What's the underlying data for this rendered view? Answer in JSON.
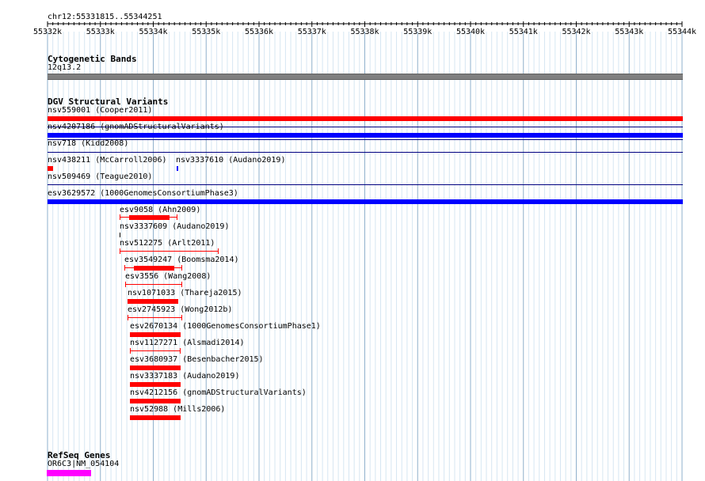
{
  "header": {
    "location": "chr12:55331815..55344251",
    "ticks": [
      "55332k",
      "55333k",
      "55334k",
      "55335k",
      "55336k",
      "55337k",
      "55338k",
      "55339k",
      "55340k",
      "55341k",
      "55342k",
      "55343k",
      "55344k"
    ]
  },
  "tracks": {
    "cytoband": {
      "title": "Cytogenetic Bands",
      "band": "12q13.2",
      "color": "#808080"
    },
    "dgv": {
      "title": "DGV Structural Variants",
      "colors": {
        "gain": "#ff0000",
        "loss": "#0000ff",
        "separator": "#000080"
      },
      "rows": [
        {
          "label": "nsv559001 (Cooper2011)"
        },
        {
          "label": "nsv4207186 (gnomADStructuralVariants)"
        },
        {
          "label": "nsv718 (Kidd2008)"
        },
        {
          "label": "nsv438211 (McCarroll2006)",
          "label2": "nsv3337610 (Audano2019)"
        },
        {
          "label": "nsv509469 (Teague2010)"
        },
        {
          "label": "esv3629572 (1000GenomesConsortiumPhase3)"
        },
        {
          "label": "esv9058 (Ahn2009)"
        },
        {
          "label": "nsv3337609 (Audano2019)"
        },
        {
          "label": "nsv512275 (Arlt2011)"
        },
        {
          "label": "esv3549247 (Boomsma2014)"
        },
        {
          "label": "esv3556 (Wang2008)"
        },
        {
          "label": "nsv1071033 (Thareja2015)"
        },
        {
          "label": "esv2745923 (Wong2012b)"
        },
        {
          "label": "esv2670134 (1000GenomesConsortiumPhase1)"
        },
        {
          "label": "nsv1127271 (Alsmadi2014)"
        },
        {
          "label": "esv3680937 (Besenbacher2015)"
        },
        {
          "label": "nsv3337183 (Audano2019)"
        },
        {
          "label": "nsv4212156 (gnomADStructuralVariants)"
        },
        {
          "label": "nsv52988 (Mills2006)"
        }
      ]
    },
    "refseq": {
      "title": "RefSeq Genes",
      "gene": "OR6C3|NM_054104",
      "color": "#ff00ff"
    }
  }
}
